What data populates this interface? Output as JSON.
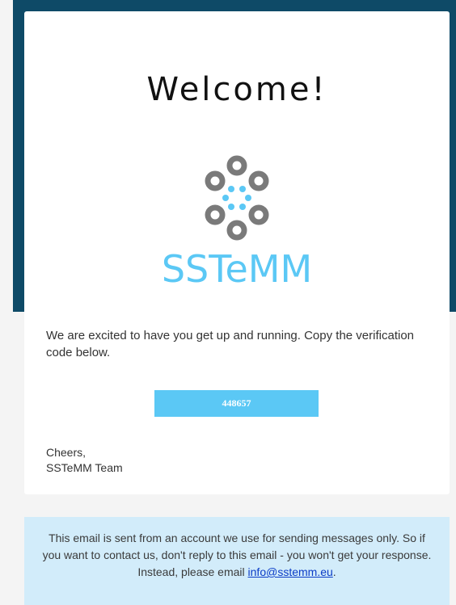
{
  "email": {
    "title": "Welcome!",
    "brand": {
      "name": "SSTeMM",
      "color": "#5bc8f5",
      "ring_color": "#7a7a7a",
      "icon": "sstemm-logo-icon"
    },
    "intro": "We are excited to have you get up and running. Copy the verification code below.",
    "verification_code": "448657",
    "signoff_line1": "Cheers,",
    "signoff_line2": "SSTeMM Team",
    "footer": {
      "text_before": "This email is sent from an account we use for sending messages only. So if you want to contact us, don't reply to this email - you won't get your response. Instead, please email ",
      "email_link": "info@sstemm.eu",
      "text_after": "."
    }
  },
  "colors": {
    "header_band": "#0e4a67",
    "page_background": "#f4f4f4",
    "card_background": "#ffffff",
    "footer_background": "#d2ecfa",
    "link": "#0b3cc7"
  }
}
